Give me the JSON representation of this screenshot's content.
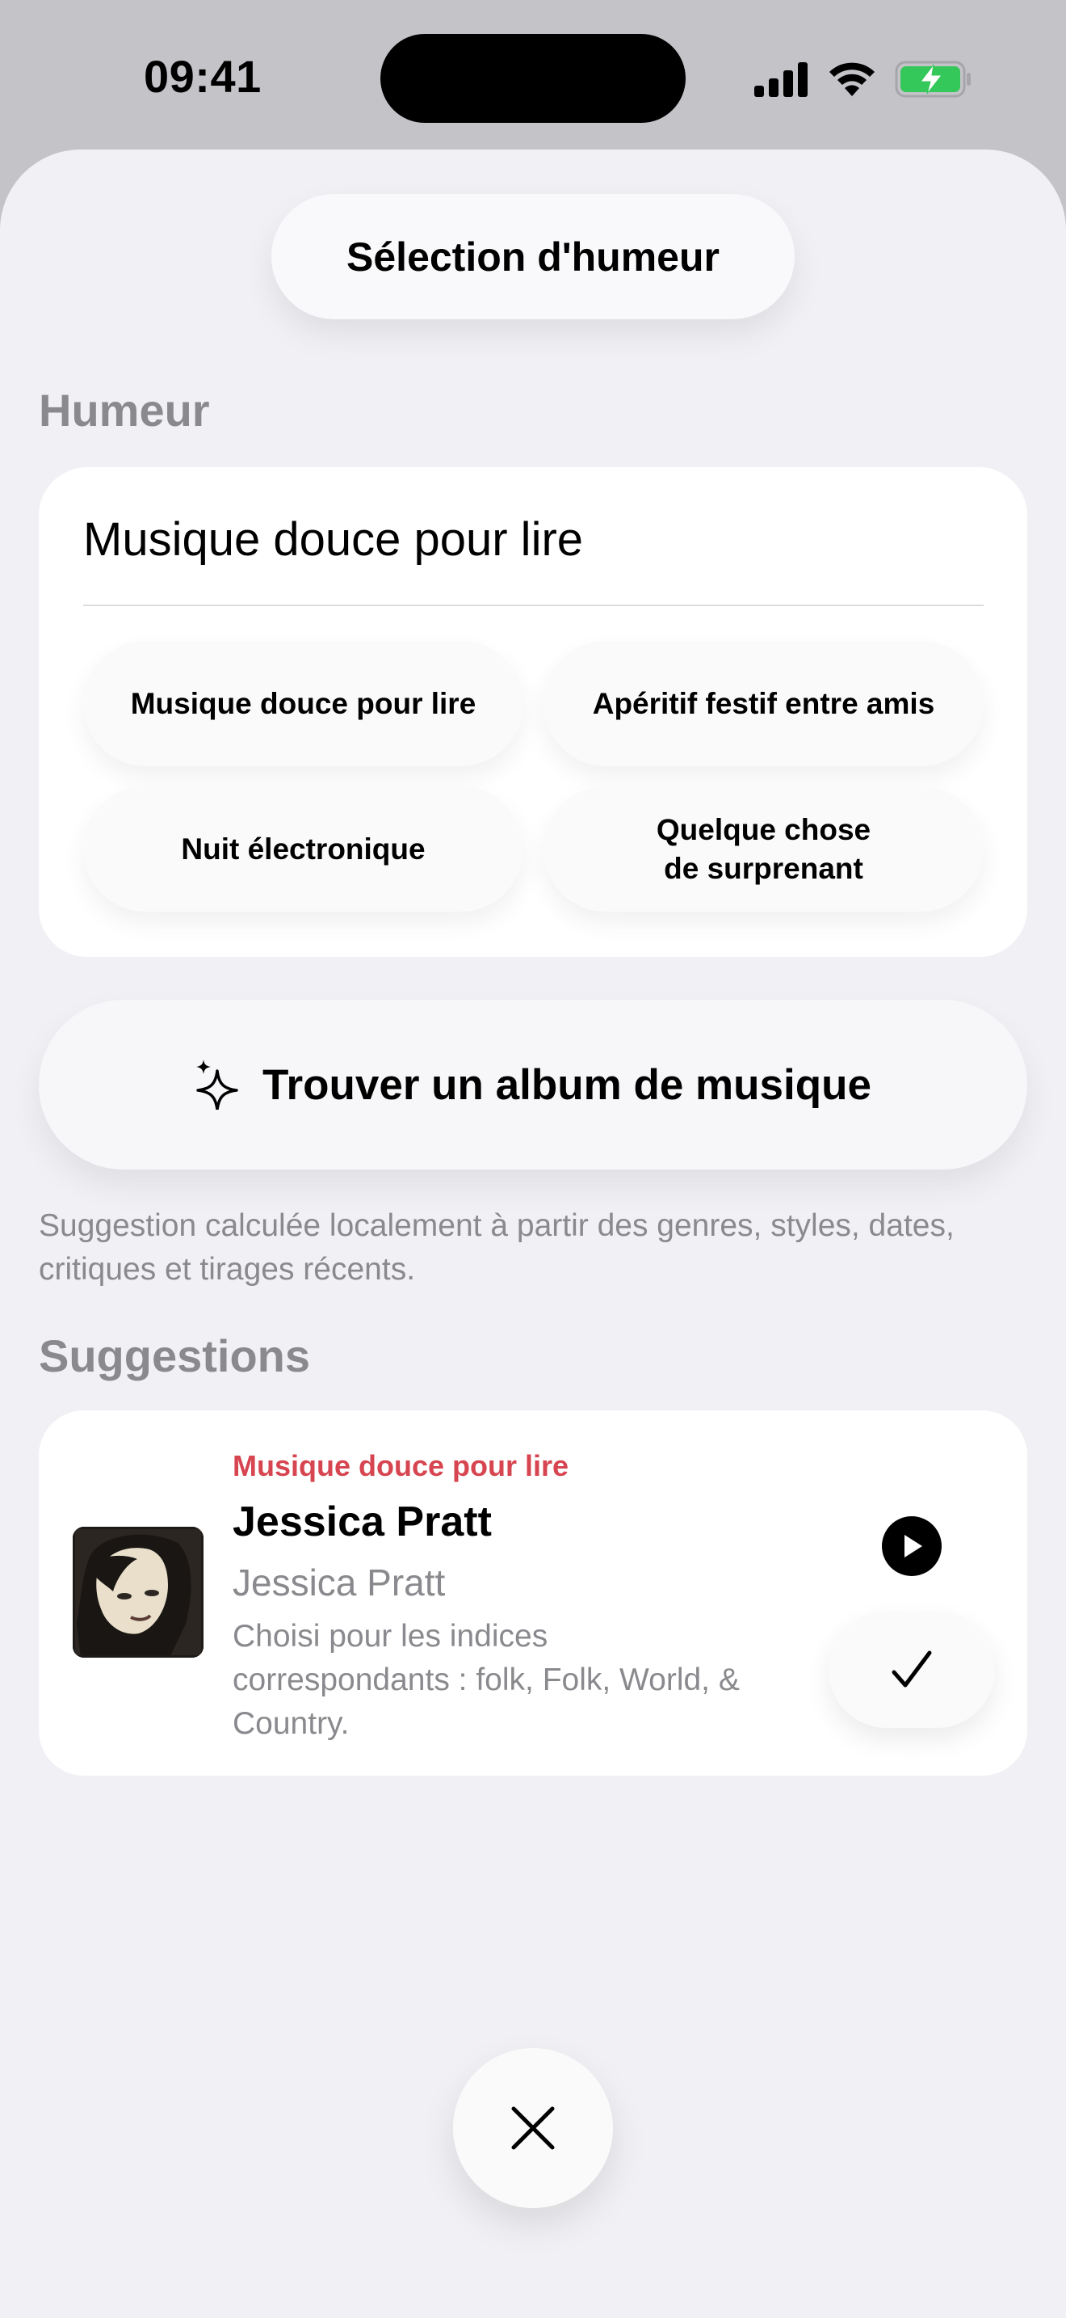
{
  "status_bar": {
    "time": "09:41",
    "icons": [
      "signal-icon",
      "wifi-icon",
      "battery-charging-icon"
    ],
    "battery_color": "#34c759"
  },
  "sheet": {
    "title": "Sélection d'humeur"
  },
  "mood_section": {
    "label": "Humeur",
    "input_value": "Musique douce pour lire",
    "chips": [
      "Musique douce pour lire",
      "Apéritif festif entre amis",
      "Nuit électronique",
      "Quelque chose\nde surprenant"
    ]
  },
  "find_button": {
    "icon": "sparkles-icon",
    "label": "Trouver un album de musique"
  },
  "footnote": "Suggestion calculée localement à partir des genres, styles, dates, critiques et tirages récents.",
  "suggestions": {
    "label": "Suggestions",
    "items": [
      {
        "mood": "Musique douce pour lire",
        "title": "Jessica Pratt",
        "artist": "Jessica Pratt",
        "reason": "Choisi pour les indices correspondants : folk, Folk, World, & Country.",
        "mood_color": "#d64550"
      }
    ]
  },
  "close_button": {
    "icon": "close-icon"
  }
}
